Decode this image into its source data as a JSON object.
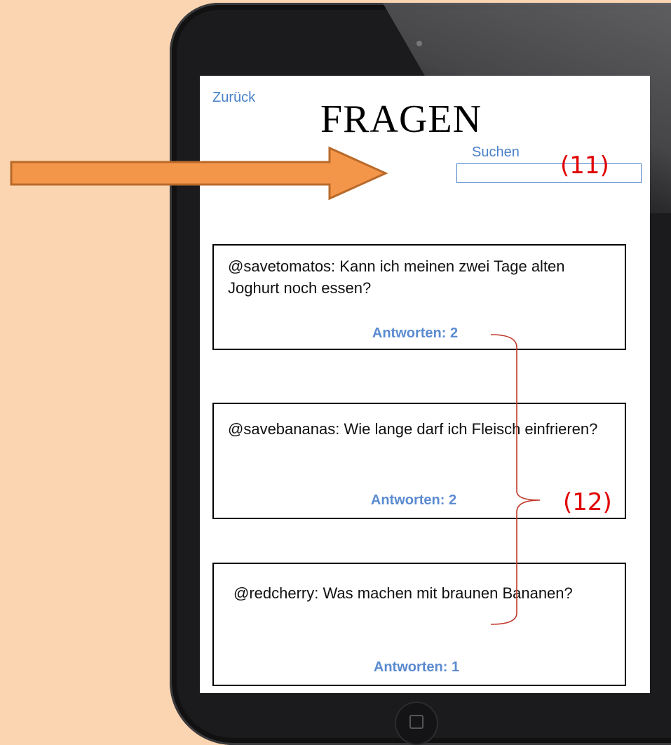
{
  "screen": {
    "back_label": "Zurück",
    "title": "FRAGEN",
    "search": {
      "label": "Suchen",
      "value": ""
    }
  },
  "questions": [
    {
      "text": "@savetomatos: Kann ich meinen zwei Tage alten Joghurt noch essen?",
      "answers_label": "Antworten: 2"
    },
    {
      "text": "@savebananas: Wie lange darf ich Fleisch einfrieren?",
      "answers_label": "Antworten: 2"
    },
    {
      "text": "@redcherry: Was machen mit braunen Bananen?",
      "answers_label": "Antworten: 1"
    }
  ],
  "annotations": {
    "search_callout": "(11)",
    "answers_callout": "(12)"
  },
  "colors": {
    "background": "#fbd5b1",
    "link": "#4a82c9",
    "answers": "#5b8bd0",
    "annotation": "#e00000",
    "arrow_fill": "#f4964a",
    "arrow_stroke": "#b96a2a"
  }
}
